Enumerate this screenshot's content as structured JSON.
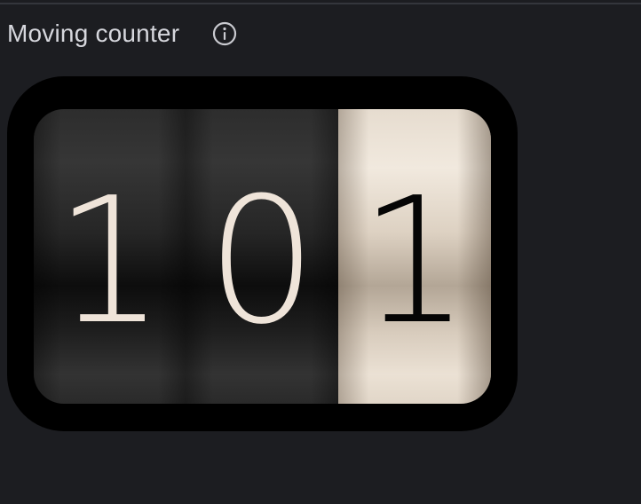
{
  "panel": {
    "title": "Moving counter",
    "info_icon": "info-circle-icon"
  },
  "counter": {
    "value": "101",
    "digits": [
      "1",
      "0",
      "1"
    ],
    "colors": {
      "frame": "#000000",
      "dark_tile_text": "#efe4d9",
      "light_tile_text": "#050505",
      "light_tile_bg": "#e6dccf",
      "dark_tile_bg": "#2d2d2d"
    }
  }
}
